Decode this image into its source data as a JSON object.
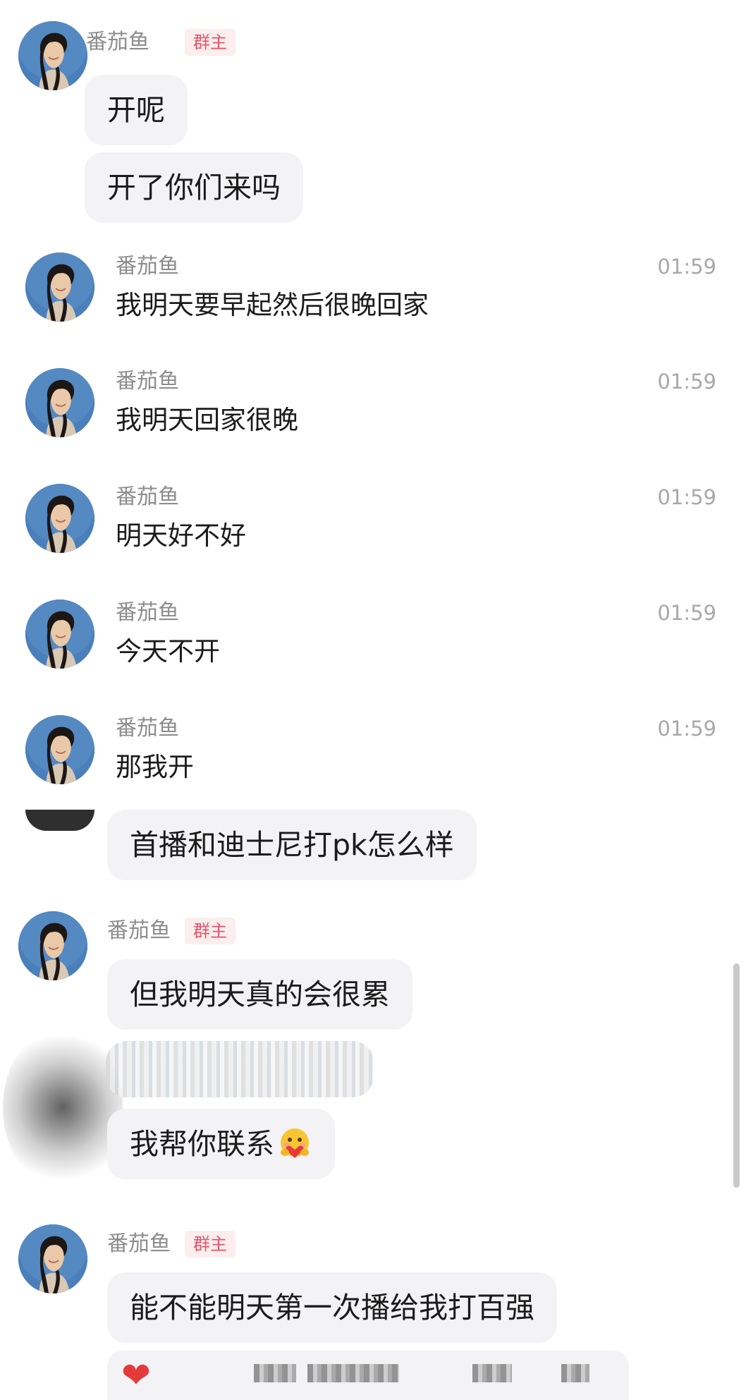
{
  "group_owner_badge": "群主",
  "sender_name": "番茄鱼",
  "messages": {
    "m1": "开呢",
    "m2": "开了你们来吗",
    "m3": "我明天要早起然后很晚回家",
    "m4": "我明天回家很晚",
    "m5": "明天好不好",
    "m6": "今天不开",
    "m7": "那我开",
    "m8": "首播和迪士尼打pk怎么样",
    "m9": "但我明天真的会很累",
    "m10": "我帮你联系",
    "m11": "能不能明天第一次播给我打百强"
  },
  "times": {
    "t3": "01:59",
    "t4": "01:59",
    "t5": "01:59",
    "t6": "01:59",
    "t7": "01:59"
  },
  "icons": {
    "emoji": "hugging-heart-emoji-icon",
    "heart": "red-heart-icon"
  },
  "colors": {
    "bubble": "#f3f3f5",
    "owner_badge_bg": "#fdeeee",
    "owner_badge_text": "#e2566a",
    "name_text": "#8d8d8d",
    "time_text": "#a8a8a8"
  }
}
